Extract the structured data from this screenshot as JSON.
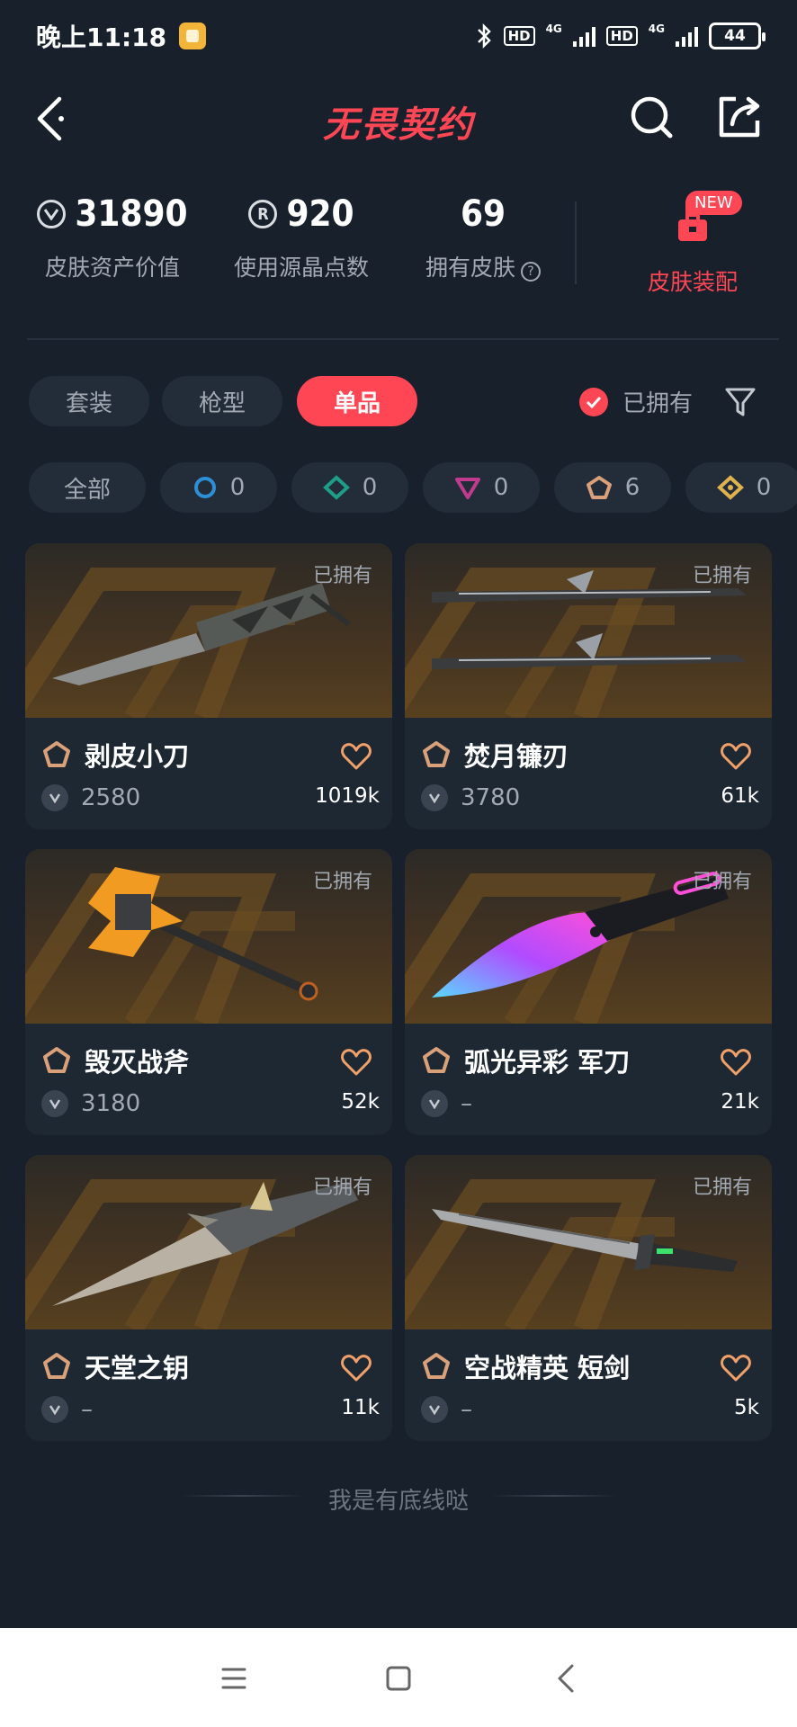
{
  "status_bar": {
    "time": "晚上11:18",
    "hd1": "HD",
    "net1": "4G",
    "hd2": "HD",
    "net2": "4G",
    "battery": "44"
  },
  "header": {
    "title": "无畏契约"
  },
  "stats": {
    "asset_value": "31890",
    "asset_label": "皮肤资产价值",
    "points_used": "920",
    "points_label": "使用源晶点数",
    "skins_owned": "69",
    "skins_label": "拥有皮肤",
    "help": "?",
    "loadout_badge": "NEW",
    "loadout_label": "皮肤装配"
  },
  "tabs": {
    "items": [
      "套装",
      "枪型",
      "单品"
    ],
    "active_index": 2,
    "owned_label": "已拥有"
  },
  "tier_chips": [
    {
      "label": "全部",
      "count": ""
    },
    {
      "label": "",
      "count": "0",
      "icon": "select-tier-icon",
      "color": "#2e8fd6"
    },
    {
      "label": "",
      "count": "0",
      "icon": "deluxe-tier-icon",
      "color": "#1e9e88"
    },
    {
      "label": "",
      "count": "0",
      "icon": "premium-tier-icon",
      "color": "#c03a8e"
    },
    {
      "label": "",
      "count": "6",
      "icon": "ultra-tier-icon",
      "color": "#d9a07a"
    },
    {
      "label": "",
      "count": "0",
      "icon": "exclusive-tier-icon",
      "color": "#e0b24e"
    }
  ],
  "cards": [
    {
      "name": "剥皮小刀",
      "price": "2580",
      "likes": "1019k",
      "owned": "已拥有",
      "art": "knife"
    },
    {
      "name": "焚月镰刃",
      "price": "3780",
      "likes": "61k",
      "owned": "已拥有",
      "art": "twin"
    },
    {
      "name": "毁灭战斧",
      "price": "3180",
      "likes": "52k",
      "owned": "已拥有",
      "art": "axe"
    },
    {
      "name": "弧光异彩 军刀",
      "price": "–",
      "likes": "21k",
      "owned": "已拥有",
      "art": "neon"
    },
    {
      "name": "天堂之钥",
      "price": "–",
      "likes": "11k",
      "owned": "已拥有",
      "art": "dagger"
    },
    {
      "name": "空战精英 短剑",
      "price": "–",
      "likes": "5k",
      "owned": "已拥有",
      "art": "shortsword"
    }
  ],
  "footer": {
    "note": "我是有底线哒"
  },
  "colors": {
    "accent": "#ff4655",
    "background": "#17202b",
    "card": "#1e2833",
    "tier_badge": "#d9a07a",
    "heart": "#f0a16a"
  }
}
